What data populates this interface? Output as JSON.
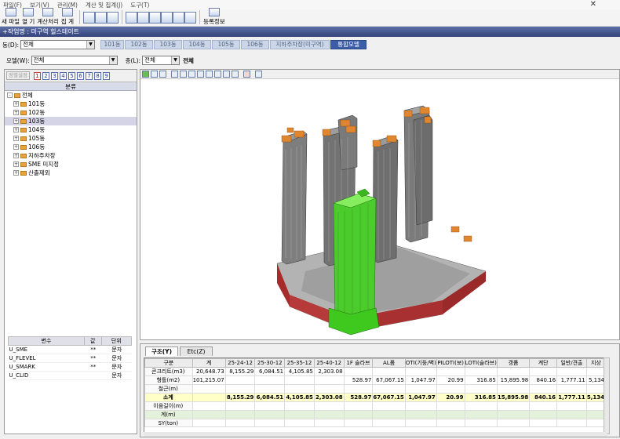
{
  "menu": [
    "파일(F)",
    "보기(V)",
    "관리(M)",
    "계산 및 집계(J)",
    "도구(T)"
  ],
  "toolbar": {
    "items": [
      {
        "name": "new-file",
        "label": "새 파일"
      },
      {
        "name": "open",
        "label": "열 기"
      },
      {
        "name": "calc",
        "label": "계산처리"
      },
      {
        "name": "sum",
        "label": "집 계"
      },
      {
        "name": "register",
        "label": "등록정보"
      }
    ]
  },
  "title": "+작업명 : 미구역 힐스테이트",
  "dong": {
    "label": "동(D):",
    "value": "전체",
    "tabs": [
      "101동",
      "102동",
      "103동",
      "104동",
      "105동",
      "106동",
      "지하주차장(미구역)",
      "통합모델"
    ],
    "active": "통합모델"
  },
  "model": {
    "label": "모델(W):",
    "value": "전체",
    "floor_label": "층(L):",
    "floor_value": "전체",
    "floor_text": "전체"
  },
  "left": {
    "sort_btn": "정렬설정",
    "numbers": [
      "1",
      "2",
      "3",
      "4",
      "5",
      "6",
      "7",
      "8",
      "9"
    ],
    "tree_header": "분류",
    "tree": [
      {
        "label": "전체",
        "level": 0,
        "box": "-"
      },
      {
        "label": "101동",
        "level": 1,
        "box": "+"
      },
      {
        "label": "102동",
        "level": 1,
        "box": "+"
      },
      {
        "label": "103동",
        "level": 1,
        "box": "+",
        "selected": true
      },
      {
        "label": "104동",
        "level": 1,
        "box": "+"
      },
      {
        "label": "105동",
        "level": 1,
        "box": "+"
      },
      {
        "label": "106동",
        "level": 1,
        "box": "+"
      },
      {
        "label": "지하주차장",
        "level": 1,
        "box": "+"
      },
      {
        "label": "SME 미지정",
        "level": 1,
        "box": "+"
      },
      {
        "label": "산출제외",
        "level": 1,
        "box": "+"
      }
    ],
    "var_headers": [
      "변수",
      "값",
      "단위"
    ],
    "vars": [
      [
        "U_SME",
        "**",
        "문자"
      ],
      [
        "U_FLEVEL",
        "**",
        "문자"
      ],
      [
        "U_SMARK",
        "**",
        "문자"
      ],
      [
        "U_CLID",
        "",
        "문자"
      ]
    ]
  },
  "bottom": {
    "tabs": [
      "구조(Y)",
      "Etc(Z)"
    ],
    "headers": [
      "구분",
      "계",
      "25-24-12",
      "25-30-12",
      "25-35-12",
      "25-40-12",
      "1F 슬라브",
      "AL폼",
      "OTI(기둥/벽)",
      "PILOTI(보)",
      "LOTI(슬라브)",
      "갱폼",
      "계단",
      "일반/견출",
      "지상"
    ],
    "rows": [
      {
        "cells": [
          "콘크리트(m3)",
          "20,648.73",
          "8,155.29",
          "6,084.51",
          "4,105.85",
          "2,303.08",
          "",
          "",
          "",
          "",
          "",
          "",
          "",
          "",
          ""
        ],
        "type": "normal"
      },
      {
        "cells": [
          "형틀(m2)",
          "101,215.07",
          "",
          "",
          "",
          "",
          "528.97",
          "67,067.15",
          "1,047.97",
          "20.99",
          "316.85",
          "15,895.98",
          "840.16",
          "1,777.11",
          "5,134"
        ],
        "type": "normal"
      },
      {
        "cells": [
          "철근(m)",
          "",
          "",
          "",
          "",
          "",
          "",
          "",
          "",
          "",
          "",
          "",
          "",
          "",
          ""
        ],
        "type": "normal"
      },
      {
        "cells": [
          "소계",
          "",
          "8,155.29",
          "6,084.51",
          "4,105.85",
          "2,303.08",
          "528.97",
          "67,067.15",
          "1,047.97",
          "20.99",
          "316.85",
          "15,895.98",
          "840.16",
          "1,777.11",
          "5,134"
        ],
        "type": "sum"
      },
      {
        "cells": [
          "이음길이(m)",
          "",
          "",
          "",
          "",
          "",
          "",
          "",
          "",
          "",
          "",
          "",
          "",
          "",
          ""
        ],
        "type": "normal"
      },
      {
        "cells": [
          "계(m)",
          "",
          "",
          "",
          "",
          "",
          "",
          "",
          "",
          "",
          "",
          "",
          "",
          "",
          ""
        ],
        "type": "green"
      },
      {
        "cells": [
          "SY(ton)",
          "",
          "",
          "",
          "",
          "",
          "",
          "",
          "",
          "",
          "",
          "",
          "",
          "",
          ""
        ],
        "type": "normal"
      }
    ]
  }
}
